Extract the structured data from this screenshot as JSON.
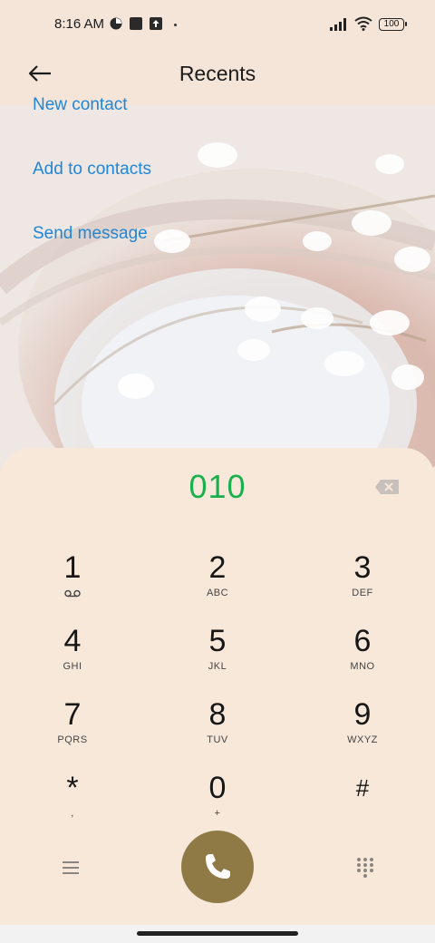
{
  "status_bar": {
    "time": "8:16 AM",
    "battery": "100",
    "icons": [
      "app-notification-icon",
      "square-notification-icon",
      "upload-notification-icon",
      "signal-icon",
      "wifi-icon",
      "battery-icon"
    ]
  },
  "header": {
    "title": "Recents",
    "back_icon": "back-arrow-icon"
  },
  "actions": [
    {
      "label": "New contact"
    },
    {
      "label": "Add to contacts"
    },
    {
      "label": "Send message"
    }
  ],
  "dialer": {
    "number": "010",
    "backspace_icon": "backspace-icon",
    "keys": [
      {
        "digit": "1",
        "letters": "",
        "icon": "voicemail-icon"
      },
      {
        "digit": "2",
        "letters": "ABC"
      },
      {
        "digit": "3",
        "letters": "DEF"
      },
      {
        "digit": "4",
        "letters": "GHI"
      },
      {
        "digit": "5",
        "letters": "JKL"
      },
      {
        "digit": "6",
        "letters": "MNO"
      },
      {
        "digit": "7",
        "letters": "PQRS"
      },
      {
        "digit": "8",
        "letters": "TUV"
      },
      {
        "digit": "9",
        "letters": "WXYZ"
      },
      {
        "digit": "*",
        "letters": ","
      },
      {
        "digit": "0",
        "letters": "+"
      },
      {
        "digit": "#",
        "letters": ""
      }
    ],
    "bottom": {
      "menu_icon": "menu-icon",
      "call_icon": "phone-icon",
      "keypad_icon": "keypad-grid-icon",
      "call_color": "#8f7a45"
    }
  },
  "colors": {
    "accent_link": "#1f86d8",
    "number_green": "#19b14d",
    "panel_bg": "#f7e8da"
  }
}
